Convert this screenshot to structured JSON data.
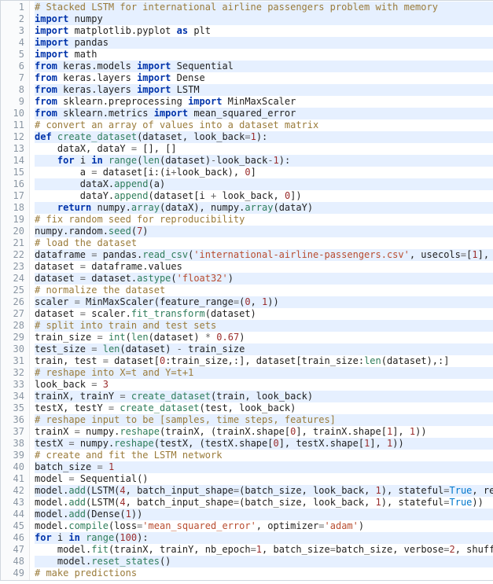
{
  "highlighted_lines": [
    1,
    2,
    4,
    6,
    8,
    10,
    12,
    14,
    16,
    18,
    20,
    22,
    24,
    26,
    28,
    30,
    32,
    34,
    36,
    38,
    40,
    42,
    44,
    46,
    48
  ],
  "lines": [
    {
      "n": 1,
      "tokens": [
        {
          "t": "# Stacked LSTM for international airline passengers problem with memory",
          "c": "c"
        }
      ]
    },
    {
      "n": 2,
      "tokens": [
        {
          "t": "import",
          "c": "kw"
        },
        {
          "t": " numpy"
        }
      ]
    },
    {
      "n": 3,
      "tokens": [
        {
          "t": "import",
          "c": "kw"
        },
        {
          "t": " matplotlib.pyplot "
        },
        {
          "t": "as",
          "c": "kw"
        },
        {
          "t": " plt"
        }
      ]
    },
    {
      "n": 4,
      "tokens": [
        {
          "t": "import",
          "c": "kw"
        },
        {
          "t": " pandas"
        }
      ]
    },
    {
      "n": 5,
      "tokens": [
        {
          "t": "import",
          "c": "kw"
        },
        {
          "t": " math"
        }
      ]
    },
    {
      "n": 6,
      "tokens": [
        {
          "t": "from",
          "c": "kw"
        },
        {
          "t": " keras.models "
        },
        {
          "t": "import",
          "c": "kw"
        },
        {
          "t": " Sequential"
        }
      ]
    },
    {
      "n": 7,
      "tokens": [
        {
          "t": "from",
          "c": "kw"
        },
        {
          "t": " keras.layers "
        },
        {
          "t": "import",
          "c": "kw"
        },
        {
          "t": " Dense"
        }
      ]
    },
    {
      "n": 8,
      "tokens": [
        {
          "t": "from",
          "c": "kw"
        },
        {
          "t": " keras.layers "
        },
        {
          "t": "import",
          "c": "kw"
        },
        {
          "t": " LSTM"
        }
      ]
    },
    {
      "n": 9,
      "tokens": [
        {
          "t": "from",
          "c": "kw"
        },
        {
          "t": " sklearn.preprocessing "
        },
        {
          "t": "import",
          "c": "kw"
        },
        {
          "t": " MinMaxScaler"
        }
      ]
    },
    {
      "n": 10,
      "tokens": [
        {
          "t": "from",
          "c": "kw"
        },
        {
          "t": " sklearn.metrics "
        },
        {
          "t": "import",
          "c": "kw"
        },
        {
          "t": " mean_squared_error"
        }
      ]
    },
    {
      "n": 11,
      "tokens": [
        {
          "t": "# convert an array of values into a dataset matrix",
          "c": "c"
        }
      ]
    },
    {
      "n": 12,
      "tokens": [
        {
          "t": "def",
          "c": "kw"
        },
        {
          "t": " "
        },
        {
          "t": "create_dataset",
          "c": "fn"
        },
        {
          "t": "(dataset, look_back"
        },
        {
          "t": "=",
          "c": "op"
        },
        {
          "t": "1",
          "c": "num"
        },
        {
          "t": "):"
        }
      ]
    },
    {
      "n": 13,
      "tokens": [
        {
          "t": "    dataX, dataY "
        },
        {
          "t": "=",
          "c": "op"
        },
        {
          "t": " [], []"
        }
      ]
    },
    {
      "n": 14,
      "tokens": [
        {
          "t": "    "
        },
        {
          "t": "for",
          "c": "kw"
        },
        {
          "t": " i "
        },
        {
          "t": "in",
          "c": "kw"
        },
        {
          "t": " "
        },
        {
          "t": "range",
          "c": "fn"
        },
        {
          "t": "("
        },
        {
          "t": "len",
          "c": "fn"
        },
        {
          "t": "(dataset)"
        },
        {
          "t": "-",
          "c": "op"
        },
        {
          "t": "look_back"
        },
        {
          "t": "-",
          "c": "op"
        },
        {
          "t": "1",
          "c": "num"
        },
        {
          "t": "):"
        }
      ]
    },
    {
      "n": 15,
      "tokens": [
        {
          "t": "        a "
        },
        {
          "t": "=",
          "c": "op"
        },
        {
          "t": " dataset[i:(i"
        },
        {
          "t": "+",
          "c": "op"
        },
        {
          "t": "look_back), "
        },
        {
          "t": "0",
          "c": "num"
        },
        {
          "t": "]"
        }
      ]
    },
    {
      "n": 16,
      "tokens": [
        {
          "t": "        dataX."
        },
        {
          "t": "append",
          "c": "fn"
        },
        {
          "t": "(a)"
        }
      ]
    },
    {
      "n": 17,
      "tokens": [
        {
          "t": "        dataY."
        },
        {
          "t": "append",
          "c": "fn"
        },
        {
          "t": "(dataset[i "
        },
        {
          "t": "+",
          "c": "op"
        },
        {
          "t": " look_back, "
        },
        {
          "t": "0",
          "c": "num"
        },
        {
          "t": "])"
        }
      ]
    },
    {
      "n": 18,
      "tokens": [
        {
          "t": "    "
        },
        {
          "t": "return",
          "c": "kw"
        },
        {
          "t": " numpy."
        },
        {
          "t": "array",
          "c": "fn"
        },
        {
          "t": "(dataX), numpy."
        },
        {
          "t": "array",
          "c": "fn"
        },
        {
          "t": "(dataY)"
        }
      ]
    },
    {
      "n": 19,
      "tokens": [
        {
          "t": "# fix random seed for reproducibility",
          "c": "c"
        }
      ]
    },
    {
      "n": 20,
      "tokens": [
        {
          "t": "numpy.random."
        },
        {
          "t": "seed",
          "c": "fn"
        },
        {
          "t": "("
        },
        {
          "t": "7",
          "c": "num"
        },
        {
          "t": ")"
        }
      ]
    },
    {
      "n": 21,
      "tokens": [
        {
          "t": "# load the dataset",
          "c": "c"
        }
      ]
    },
    {
      "n": 22,
      "tokens": [
        {
          "t": "dataframe "
        },
        {
          "t": "=",
          "c": "op"
        },
        {
          "t": " pandas."
        },
        {
          "t": "read_csv",
          "c": "fn"
        },
        {
          "t": "("
        },
        {
          "t": "'international-airline-passengers.csv'",
          "c": "str"
        },
        {
          "t": ", usecols"
        },
        {
          "t": "=",
          "c": "op"
        },
        {
          "t": "["
        },
        {
          "t": "1",
          "c": "num"
        },
        {
          "t": "], eng"
        }
      ]
    },
    {
      "n": 23,
      "tokens": [
        {
          "t": "dataset "
        },
        {
          "t": "=",
          "c": "op"
        },
        {
          "t": " dataframe.values"
        }
      ]
    },
    {
      "n": 24,
      "tokens": [
        {
          "t": "dataset "
        },
        {
          "t": "=",
          "c": "op"
        },
        {
          "t": " dataset."
        },
        {
          "t": "astype",
          "c": "fn"
        },
        {
          "t": "("
        },
        {
          "t": "'float32'",
          "c": "str"
        },
        {
          "t": ")"
        }
      ]
    },
    {
      "n": 25,
      "tokens": [
        {
          "t": "# normalize the dataset",
          "c": "c"
        }
      ]
    },
    {
      "n": 26,
      "tokens": [
        {
          "t": "scaler "
        },
        {
          "t": "=",
          "c": "op"
        },
        {
          "t": " MinMaxScaler(feature_range"
        },
        {
          "t": "=",
          "c": "op"
        },
        {
          "t": "("
        },
        {
          "t": "0",
          "c": "num"
        },
        {
          "t": ", "
        },
        {
          "t": "1",
          "c": "num"
        },
        {
          "t": "))"
        }
      ]
    },
    {
      "n": 27,
      "tokens": [
        {
          "t": "dataset "
        },
        {
          "t": "=",
          "c": "op"
        },
        {
          "t": " scaler."
        },
        {
          "t": "fit_transform",
          "c": "fn"
        },
        {
          "t": "(dataset)"
        }
      ]
    },
    {
      "n": 28,
      "tokens": [
        {
          "t": "# split into train and test sets",
          "c": "c"
        }
      ]
    },
    {
      "n": 29,
      "tokens": [
        {
          "t": "train_size "
        },
        {
          "t": "=",
          "c": "op"
        },
        {
          "t": " "
        },
        {
          "t": "int",
          "c": "fn"
        },
        {
          "t": "("
        },
        {
          "t": "len",
          "c": "fn"
        },
        {
          "t": "(dataset) "
        },
        {
          "t": "*",
          "c": "op"
        },
        {
          "t": " "
        },
        {
          "t": "0.67",
          "c": "num"
        },
        {
          "t": ")"
        }
      ]
    },
    {
      "n": 30,
      "tokens": [
        {
          "t": "test_size "
        },
        {
          "t": "=",
          "c": "op"
        },
        {
          "t": " "
        },
        {
          "t": "len",
          "c": "fn"
        },
        {
          "t": "(dataset) "
        },
        {
          "t": "-",
          "c": "op"
        },
        {
          "t": " train_size"
        }
      ]
    },
    {
      "n": 31,
      "tokens": [
        {
          "t": "train, test "
        },
        {
          "t": "=",
          "c": "op"
        },
        {
          "t": " dataset["
        },
        {
          "t": "0",
          "c": "num"
        },
        {
          "t": ":train_size,:], dataset[train_size:"
        },
        {
          "t": "len",
          "c": "fn"
        },
        {
          "t": "(dataset),:]"
        }
      ]
    },
    {
      "n": 32,
      "tokens": [
        {
          "t": "# reshape into X=t and Y=t+1",
          "c": "c"
        }
      ]
    },
    {
      "n": 33,
      "tokens": [
        {
          "t": "look_back "
        },
        {
          "t": "=",
          "c": "op"
        },
        {
          "t": " "
        },
        {
          "t": "3",
          "c": "num"
        }
      ]
    },
    {
      "n": 34,
      "tokens": [
        {
          "t": "trainX, trainY "
        },
        {
          "t": "=",
          "c": "op"
        },
        {
          "t": " "
        },
        {
          "t": "create_dataset",
          "c": "fn"
        },
        {
          "t": "(train, look_back)"
        }
      ]
    },
    {
      "n": 35,
      "tokens": [
        {
          "t": "testX, testY "
        },
        {
          "t": "=",
          "c": "op"
        },
        {
          "t": " "
        },
        {
          "t": "create_dataset",
          "c": "fn"
        },
        {
          "t": "(test, look_back)"
        }
      ]
    },
    {
      "n": 36,
      "tokens": [
        {
          "t": "# reshape input to be [samples, time steps, features]",
          "c": "c"
        }
      ]
    },
    {
      "n": 37,
      "tokens": [
        {
          "t": "trainX "
        },
        {
          "t": "=",
          "c": "op"
        },
        {
          "t": " numpy."
        },
        {
          "t": "reshape",
          "c": "fn"
        },
        {
          "t": "(trainX, (trainX.shape["
        },
        {
          "t": "0",
          "c": "num"
        },
        {
          "t": "], trainX.shape["
        },
        {
          "t": "1",
          "c": "num"
        },
        {
          "t": "], "
        },
        {
          "t": "1",
          "c": "num"
        },
        {
          "t": "))"
        }
      ]
    },
    {
      "n": 38,
      "tokens": [
        {
          "t": "testX "
        },
        {
          "t": "=",
          "c": "op"
        },
        {
          "t": " numpy."
        },
        {
          "t": "reshape",
          "c": "fn"
        },
        {
          "t": "(testX, (testX.shape["
        },
        {
          "t": "0",
          "c": "num"
        },
        {
          "t": "], testX.shape["
        },
        {
          "t": "1",
          "c": "num"
        },
        {
          "t": "], "
        },
        {
          "t": "1",
          "c": "num"
        },
        {
          "t": "))"
        }
      ]
    },
    {
      "n": 39,
      "tokens": [
        {
          "t": "# create and fit the LSTM network",
          "c": "c"
        }
      ]
    },
    {
      "n": 40,
      "tokens": [
        {
          "t": "batch_size "
        },
        {
          "t": "=",
          "c": "op"
        },
        {
          "t": " "
        },
        {
          "t": "1",
          "c": "num"
        }
      ]
    },
    {
      "n": 41,
      "tokens": [
        {
          "t": "model "
        },
        {
          "t": "=",
          "c": "op"
        },
        {
          "t": " Sequential()"
        }
      ]
    },
    {
      "n": 42,
      "tokens": [
        {
          "t": "model."
        },
        {
          "t": "add",
          "c": "fn"
        },
        {
          "t": "(LSTM("
        },
        {
          "t": "4",
          "c": "num"
        },
        {
          "t": ", batch_input_shape"
        },
        {
          "t": "=",
          "c": "op"
        },
        {
          "t": "(batch_size, look_back, "
        },
        {
          "t": "1",
          "c": "num"
        },
        {
          "t": "), stateful"
        },
        {
          "t": "=",
          "c": "op"
        },
        {
          "t": "True",
          "c": "bl"
        },
        {
          "t": ", return"
        }
      ]
    },
    {
      "n": 43,
      "tokens": [
        {
          "t": "model."
        },
        {
          "t": "add",
          "c": "fn"
        },
        {
          "t": "(LSTM("
        },
        {
          "t": "4",
          "c": "num"
        },
        {
          "t": ", batch_input_shape"
        },
        {
          "t": "=",
          "c": "op"
        },
        {
          "t": "(batch_size, look_back, "
        },
        {
          "t": "1",
          "c": "num"
        },
        {
          "t": "), stateful"
        },
        {
          "t": "=",
          "c": "op"
        },
        {
          "t": "True",
          "c": "bl"
        },
        {
          "t": "))"
        }
      ]
    },
    {
      "n": 44,
      "tokens": [
        {
          "t": "model."
        },
        {
          "t": "add",
          "c": "fn"
        },
        {
          "t": "(Dense("
        },
        {
          "t": "1",
          "c": "num"
        },
        {
          "t": "))"
        }
      ]
    },
    {
      "n": 45,
      "tokens": [
        {
          "t": "model."
        },
        {
          "t": "compile",
          "c": "fn"
        },
        {
          "t": "(loss"
        },
        {
          "t": "=",
          "c": "op"
        },
        {
          "t": "'mean_squared_error'",
          "c": "str"
        },
        {
          "t": ", optimizer"
        },
        {
          "t": "=",
          "c": "op"
        },
        {
          "t": "'adam'",
          "c": "str"
        },
        {
          "t": ")"
        }
      ]
    },
    {
      "n": 46,
      "tokens": [
        {
          "t": "for",
          "c": "kw"
        },
        {
          "t": " i "
        },
        {
          "t": "in",
          "c": "kw"
        },
        {
          "t": " "
        },
        {
          "t": "range",
          "c": "fn"
        },
        {
          "t": "("
        },
        {
          "t": "100",
          "c": "num"
        },
        {
          "t": "):"
        }
      ]
    },
    {
      "n": 47,
      "tokens": [
        {
          "t": "    model."
        },
        {
          "t": "fit",
          "c": "fn"
        },
        {
          "t": "(trainX, trainY, nb_epoch"
        },
        {
          "t": "=",
          "c": "op"
        },
        {
          "t": "1",
          "c": "num"
        },
        {
          "t": ", batch_size"
        },
        {
          "t": "=",
          "c": "op"
        },
        {
          "t": "batch_size, verbose"
        },
        {
          "t": "=",
          "c": "op"
        },
        {
          "t": "2",
          "c": "num"
        },
        {
          "t": ", shuffle"
        },
        {
          "t": "=",
          "c": "op"
        }
      ]
    },
    {
      "n": 48,
      "tokens": [
        {
          "t": "    model."
        },
        {
          "t": "reset_states",
          "c": "fn"
        },
        {
          "t": "()"
        }
      ]
    },
    {
      "n": 49,
      "tokens": [
        {
          "t": "# make predictions",
          "c": "c"
        }
      ]
    }
  ]
}
